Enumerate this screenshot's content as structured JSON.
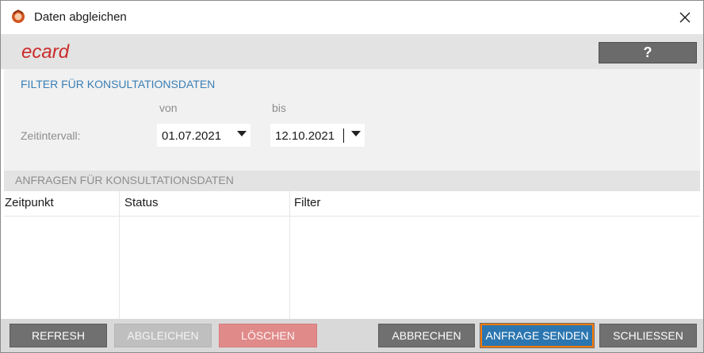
{
  "window": {
    "title": "Daten abgleichen"
  },
  "header": {
    "logo_text": "ecard",
    "help_label": "?"
  },
  "filter": {
    "title": "FILTER FÜR KONSULTATIONSDATEN",
    "from_label": "von",
    "to_label": "bis",
    "interval_label": "Zeitintervall:",
    "from_value": "01.07.2021",
    "to_value": "12.10.2021"
  },
  "requests": {
    "title": "ANFRAGEN FÜR KONSULTATIONSDATEN",
    "columns": [
      "Zeitpunkt",
      "Status",
      "Filter"
    ],
    "rows": []
  },
  "buttons": {
    "refresh": "REFRESH",
    "sync": "ABGLEICHEN",
    "delete": "LÖSCHEN",
    "cancel": "ABBRECHEN",
    "send": "ANFRAGE SENDEN",
    "close": "SCHLIESSEN"
  },
  "colors": {
    "accent": "#3a7fb5",
    "primary_button": "#2b76b0",
    "focus_ring": "#ff7a00",
    "dark_button": "#707070",
    "danger_disabled": "#e08a8a"
  },
  "icons": {
    "app": "ecard-app-icon",
    "close": "close-icon",
    "dropdown": "chevron-down-icon"
  }
}
